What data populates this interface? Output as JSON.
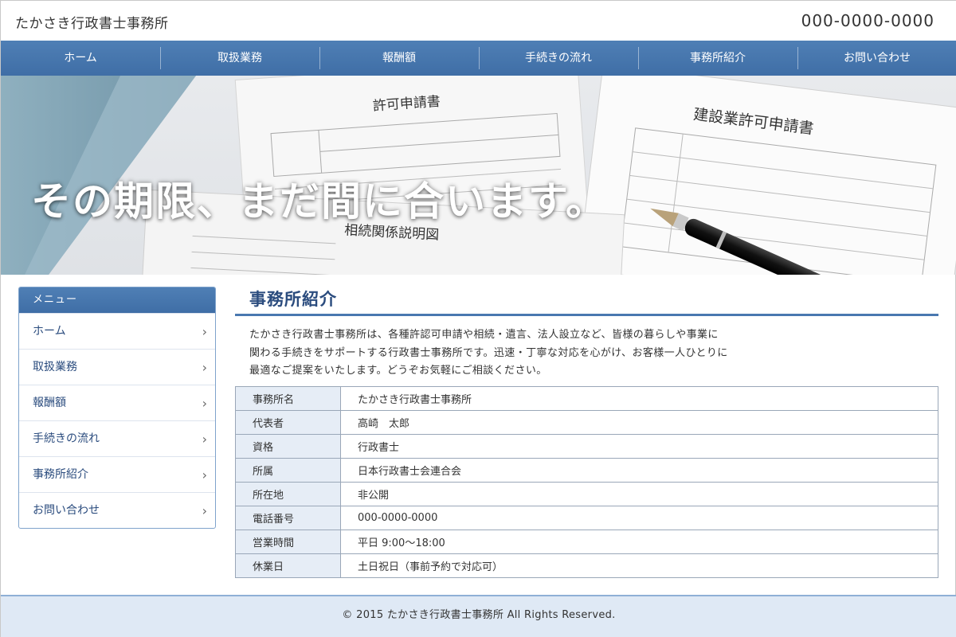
{
  "header": {
    "site_title": "たかさき行政書士事務所",
    "phone": "000-0000-0000"
  },
  "nav": {
    "items": [
      {
        "label": "ホーム"
      },
      {
        "label": "取扱業務"
      },
      {
        "label": "報酬額"
      },
      {
        "label": "手続きの流れ"
      },
      {
        "label": "事務所紹介"
      },
      {
        "label": "お問い合わせ"
      }
    ]
  },
  "hero": {
    "catchcopy": "その期限、まだ間に合います。",
    "doc1_title": "許可申請書",
    "doc2_title": "建設業許可申請書",
    "doc3_title": "相続関係説明図"
  },
  "sidebar": {
    "heading": "メニュー",
    "items": [
      {
        "label": "ホーム",
        "arrow": "›"
      },
      {
        "label": "取扱業務",
        "arrow": "›"
      },
      {
        "label": "報酬額",
        "arrow": "›"
      },
      {
        "label": "手続きの流れ",
        "arrow": "›"
      },
      {
        "label": "事務所紹介",
        "arrow": "›"
      },
      {
        "label": "お問い合わせ",
        "arrow": "›"
      }
    ]
  },
  "main": {
    "title": "事務所紹介",
    "intro_lines": [
      "たかさき行政書士事務所は、各種許認可申請や相続・遺言、法人設立など、皆様の暮らしや事業に",
      "関わる手続きをサポートする行政書士事務所です。迅速・丁寧な対応を心がけ、お客様一人ひとりに",
      "最適なご提案をいたします。どうぞお気軽にご相談ください。"
    ],
    "table": [
      {
        "label": "事務所名",
        "value": "たかさき行政書士事務所"
      },
      {
        "label": "代表者",
        "value": "高崎　太郎"
      },
      {
        "label": "資格",
        "value": "行政書士"
      },
      {
        "label": "所属",
        "value": "日本行政書士会連合会"
      },
      {
        "label": "所在地",
        "value": "非公開"
      },
      {
        "label": "電話番号",
        "value": "000-0000-0000"
      },
      {
        "label": "営業時間",
        "value": "平日 9:00〜18:00"
      },
      {
        "label": "休業日",
        "value": "土日祝日（事前予約で対応可）"
      }
    ]
  },
  "footer": {
    "copyright": "© 2015 たかさき行政書士事務所 All Rights Reserved."
  },
  "colors": {
    "accent": "#3f6ea6",
    "heading_text": "#2b4c7e",
    "table_header_bg": "#e6edf6",
    "footer_bg": "#dfe9f5"
  }
}
